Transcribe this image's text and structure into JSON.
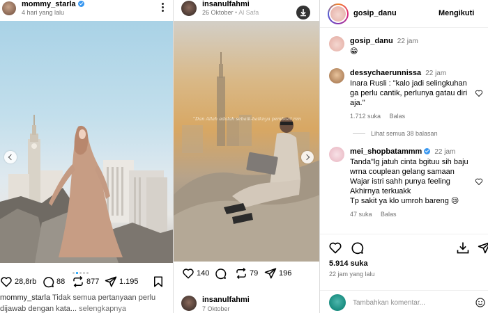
{
  "left_post": {
    "username": "mommy_starla",
    "time": "4 hari yang lalu",
    "likes": "28,8rb",
    "comments": "88",
    "reposts": "877",
    "shares": "1.195",
    "caption_user": "mommy_starla",
    "caption_text": "Tidak semua pertanyaan perlu dijawab dengan kata...",
    "caption_more": "selengkapnya",
    "carousel_dots": 5,
    "active_dot": 1
  },
  "middle_post": {
    "username": "insanulfahmi",
    "date": "26 Oktober",
    "location": "Al Safa",
    "quote": "\"Dan Allah adalah sebaik-baiknya pembuat ren",
    "likes": "140",
    "reposts": "79",
    "shares": "196",
    "next_username": "insanulfahmi",
    "next_date": "7 Oktober"
  },
  "right_panel": {
    "account": "gosip_danu",
    "follow_label": "Mengikuti",
    "caption_user": "gosip_danu",
    "caption_time": "22 jam",
    "caption_emoji": "😁",
    "comments": [
      {
        "user": "dessychaerunnissa",
        "time": "22 jam",
        "text": "Inara Rusli : \"kalo jadi selingkuhan ga perlu cantik, perlunya gatau diri aja.\"",
        "likes": "1.712 suka",
        "reply": "Balas"
      },
      {
        "user": "mei_shopbatammm",
        "time": "22 jam",
        "text": "Tanda\"lg jatuh cinta bgituu sih baju wrna couplean gelang samaan\nWajar istri sahh punya feeling\nAkhirnya terkuakk\nTp sakit ya klo umroh bareng 😢",
        "likes": "47 suka",
        "reply": "Balas"
      }
    ],
    "see_all": "Lihat semua 38 balasan",
    "total_likes": "5.914 suka",
    "posted_ago": "22 jam yang lalu",
    "add_comment_placeholder": "Tambahkan komentar..."
  },
  "colors": {
    "verified": "#3897f0",
    "link": "#0095f6",
    "muted": "#737373"
  }
}
